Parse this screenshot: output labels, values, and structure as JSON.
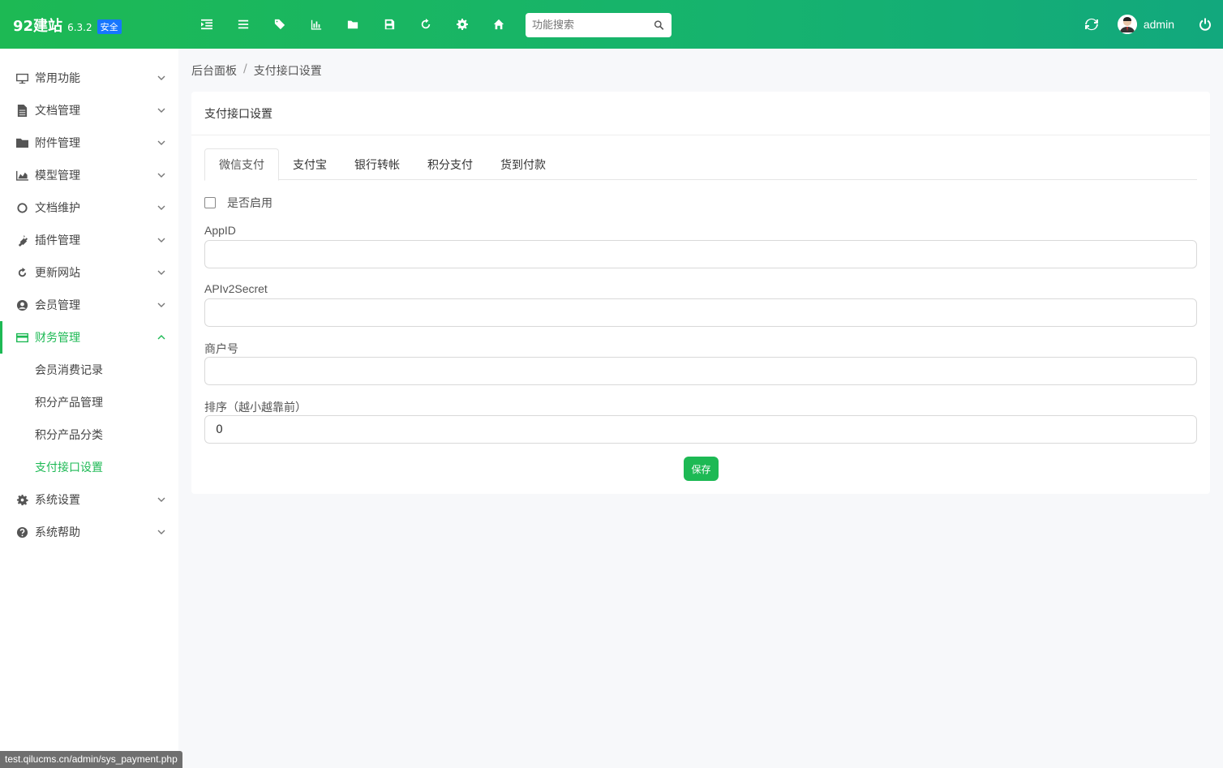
{
  "brand": {
    "name": "92建站",
    "version": "6.3.2",
    "badge": "安全"
  },
  "toolbar": {
    "icons": [
      "indent-icon",
      "list-icon",
      "tags-icon",
      "bar-chart-icon",
      "folder-icon",
      "save-icon",
      "refresh-icon",
      "gear-icon",
      "home-icon"
    ]
  },
  "search": {
    "placeholder": "功能搜索"
  },
  "user": {
    "name": "admin"
  },
  "sidebar": {
    "items": [
      {
        "label": "常用功能",
        "icon": "desktop-icon"
      },
      {
        "label": "文档管理",
        "icon": "file-icon"
      },
      {
        "label": "附件管理",
        "icon": "folder-icon"
      },
      {
        "label": "模型管理",
        "icon": "area-chart-icon"
      },
      {
        "label": "文档维护",
        "icon": "circle-icon"
      },
      {
        "label": "插件管理",
        "icon": "plug-icon"
      },
      {
        "label": "更新网站",
        "icon": "refresh-icon"
      },
      {
        "label": "会员管理",
        "icon": "user-circle-icon"
      },
      {
        "label": "财务管理",
        "icon": "credit-card-icon",
        "expanded": true
      },
      {
        "label": "系统设置",
        "icon": "gear-icon"
      },
      {
        "label": "系统帮助",
        "icon": "question-icon"
      }
    ],
    "finance_sub": [
      "会员消费记录",
      "积分产品管理",
      "积分产品分类",
      "支付接口设置"
    ]
  },
  "breadcrumb": {
    "home": "后台面板",
    "sep": "/",
    "current": "支付接口设置"
  },
  "card": {
    "title": "支付接口设置",
    "tabs": [
      "微信支付",
      "支付宝",
      "银行转帐",
      "积分支付",
      "货到付款"
    ],
    "enable_label": "是否启用",
    "fields": [
      {
        "label": "AppID",
        "value": ""
      },
      {
        "label": "APIv2Secret",
        "value": ""
      },
      {
        "label": "商户号",
        "value": ""
      },
      {
        "label": "排序（越小越靠前）",
        "value": "0"
      }
    ],
    "save_label": "保存"
  },
  "status_url": "test.qilucms.cn/admin/sys_payment.php",
  "colors": {
    "accent": "#1db954",
    "badge": "#1677ff"
  }
}
